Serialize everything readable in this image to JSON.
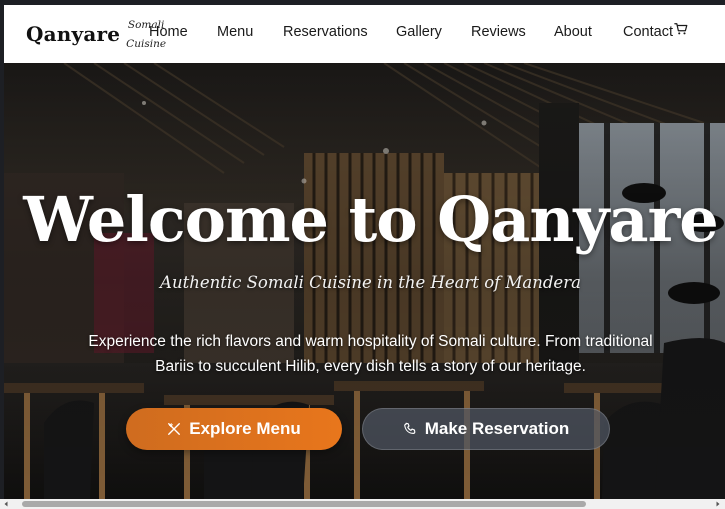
{
  "brand": {
    "name": "Qanyare",
    "tagline_line1": "Somali",
    "tagline_line2": "Cuisine"
  },
  "nav": {
    "items": [
      {
        "label": "Home"
      },
      {
        "label": "Menu"
      },
      {
        "label": "Reservations"
      },
      {
        "label": "Gallery"
      },
      {
        "label": "Reviews"
      },
      {
        "label": "About"
      },
      {
        "label": "Contact"
      }
    ],
    "cart_icon": "cart-icon"
  },
  "hero": {
    "title": "Welcome to Qanyare",
    "subtitle": "Authentic Somali Cuisine in the Heart of Mandera",
    "description": "Experience the rich flavors and warm hospitality of Somali culture. From traditional Bariis to succulent Hilib, every dish tells a story of our heritage.",
    "explore_button": {
      "label": "Explore Menu",
      "icon": "utensils-icon"
    },
    "reserve_button": {
      "label": "Make Reservation",
      "icon": "phone-icon"
    }
  },
  "colors": {
    "accent": "#e8761c",
    "header_bg": "#ffffff",
    "text_dark": "#1a1a1a"
  }
}
